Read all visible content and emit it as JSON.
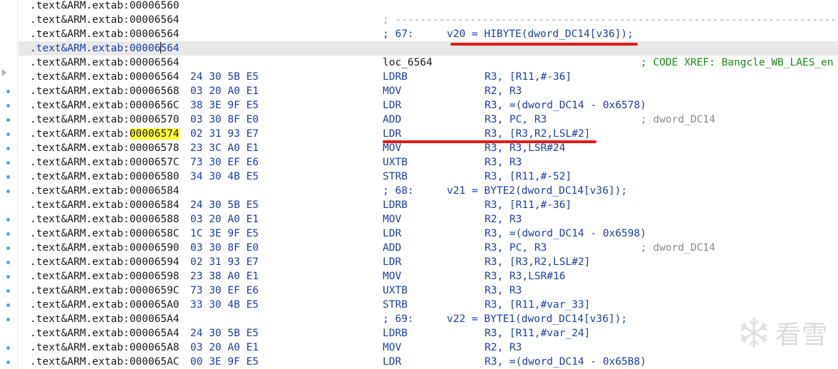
{
  "segment": ".text&ARM.extab",
  "current_row": 3,
  "highlighted_row": 9,
  "breakpoint_rows": [
    6,
    7,
    8,
    9,
    10,
    11,
    12,
    13,
    15,
    16,
    17,
    18,
    19,
    20,
    21,
    22,
    24,
    25
  ],
  "rows": [
    {
      "addr": "00006560"
    },
    {
      "addr": "00006564",
      "separator": "; ---------------------------------------------------------------------------"
    },
    {
      "addr": "00006564",
      "src_num": "; 67:",
      "src_code": "v20 = HIBYTE(dword_DC14[v36]);"
    },
    {
      "addr": "00006564"
    },
    {
      "addr": "00006564",
      "label": "loc_6564",
      "ref": "; CODE XREF: Bangcle_WB_LAES_en"
    },
    {
      "addr": "00006564",
      "bytes": "24 30 5B E5",
      "mnemonic": "LDRB",
      "operands": "R3, [R11,#-36]"
    },
    {
      "addr": "00006568",
      "bytes": "03 20 A0 E1",
      "mnemonic": "MOV",
      "operands": "R2, R3"
    },
    {
      "addr": "0000656C",
      "bytes": "38 3E 9F E5",
      "mnemonic": "LDR",
      "operands": "R3, =(dword_DC14 - 0x6578)"
    },
    {
      "addr": "00006570",
      "bytes": "03 30 8F E0",
      "mnemonic": "ADD",
      "operands": "R3, PC, R3",
      "comment": "; dword_DC14"
    },
    {
      "addr": "00006574",
      "bytes": "02 31 93 E7",
      "mnemonic": "LDR",
      "operands": "R3, [R3,R2,LSL#2]"
    },
    {
      "addr": "00006578",
      "bytes": "23 3C A0 E1",
      "mnemonic": "MOV",
      "operands": "R3, R3,LSR#24"
    },
    {
      "addr": "0000657C",
      "bytes": "73 30 EF E6",
      "mnemonic": "UXTB",
      "operands": "R3, R3"
    },
    {
      "addr": "00006580",
      "bytes": "34 30 4B E5",
      "mnemonic": "STRB",
      "operands": "R3, [R11,#-52]"
    },
    {
      "addr": "00006584",
      "src_num": "; 68:",
      "src_code": "v21 = BYTE2(dword_DC14[v36]);"
    },
    {
      "addr": "00006584",
      "bytes": "24 30 5B E5",
      "mnemonic": "LDRB",
      "operands": "R3, [R11,#-36]"
    },
    {
      "addr": "00006588",
      "bytes": "03 20 A0 E1",
      "mnemonic": "MOV",
      "operands": "R2, R3"
    },
    {
      "addr": "0000658C",
      "bytes": "1C 3E 9F E5",
      "mnemonic": "LDR",
      "operands": "R3, =(dword_DC14 - 0x6598)"
    },
    {
      "addr": "00006590",
      "bytes": "03 30 8F E0",
      "mnemonic": "ADD",
      "operands": "R3, PC, R3",
      "comment": "; dword_DC14"
    },
    {
      "addr": "00006594",
      "bytes": "02 31 93 E7",
      "mnemonic": "LDR",
      "operands": "R3, [R3,R2,LSL#2]"
    },
    {
      "addr": "00006598",
      "bytes": "23 38 A0 E1",
      "mnemonic": "MOV",
      "operands": "R3, R3,LSR#16"
    },
    {
      "addr": "0000659C",
      "bytes": "73 30 EF E6",
      "mnemonic": "UXTB",
      "operands": "R3, R3"
    },
    {
      "addr": "000065A0",
      "bytes": "33 30 4B E5",
      "mnemonic": "STRB",
      "operands": "R3, [R11,#var_33]"
    },
    {
      "addr": "000065A4",
      "src_num": "; 69:",
      "src_code": "v22 = BYTE1(dword_DC14[v36]);"
    },
    {
      "addr": "000065A4",
      "bytes": "24 30 5B E5",
      "mnemonic": "LDRB",
      "operands": "R3, [R11,#var_24]"
    },
    {
      "addr": "000065A8",
      "bytes": "03 20 A0 E1",
      "mnemonic": "MOV",
      "operands": "R2, R3"
    },
    {
      "addr": "000065AC",
      "bytes": "00 3E 9F E5",
      "mnemonic": "LDR",
      "operands": "R3, =(dword_DC14 - 0x65B8)"
    }
  ],
  "watermark": {
    "text": "看雪",
    "icon": "snowflake-icon"
  },
  "colors": {
    "highlight": "#ffff3a",
    "annotation_red": "#e01b1b",
    "code_blue": "#1c3fa6",
    "xref_green": "#178a17"
  }
}
